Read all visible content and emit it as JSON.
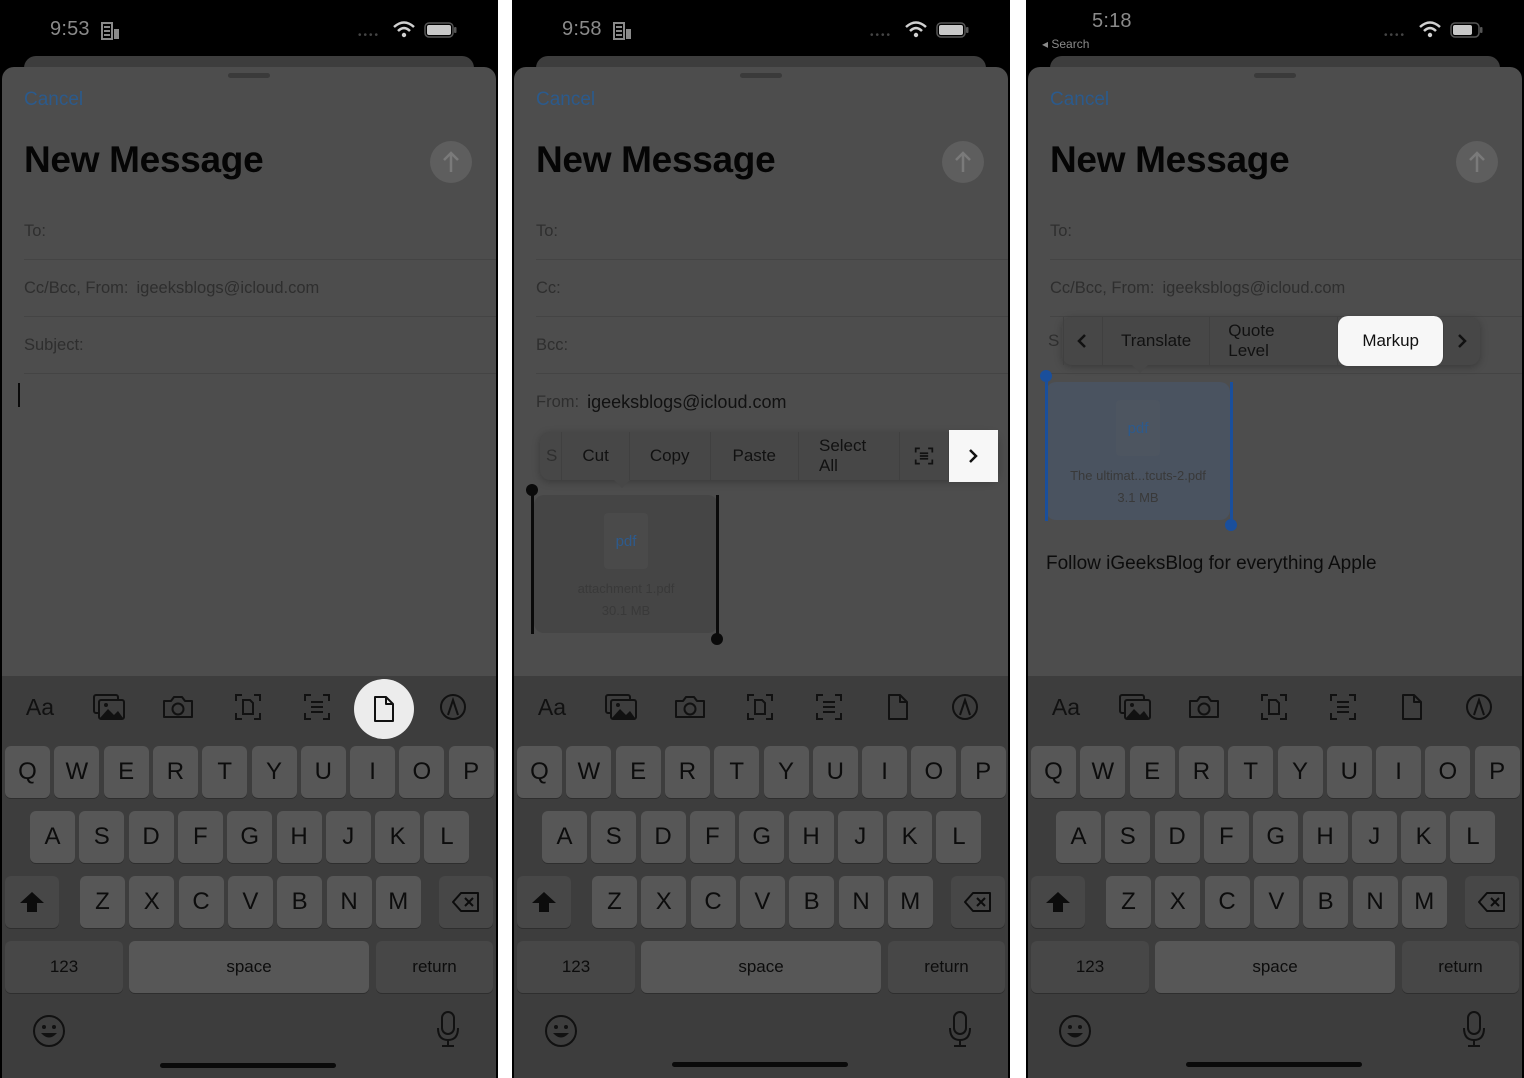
{
  "panels": [
    {
      "status": {
        "time": "9:53",
        "back_label": null
      },
      "compose": {
        "cancel": "Cancel",
        "title": "New Message",
        "fields": [
          {
            "label": "To:",
            "value": ""
          },
          {
            "label": "Cc/Bcc, From:",
            "value": "igeeksblogs@icloud.com"
          },
          {
            "label": "Subject:",
            "value": ""
          }
        ]
      },
      "toolbar": {
        "items": [
          "format-text",
          "photo-library",
          "camera",
          "scan-document",
          "scan-text",
          "attach-file",
          "markup"
        ],
        "format_label": "Aa",
        "highlighted": "attach-file"
      }
    },
    {
      "status": {
        "time": "9:58",
        "back_label": null
      },
      "compose": {
        "cancel": "Cancel",
        "title": "New Message",
        "fields": [
          {
            "label": "To:",
            "value": ""
          },
          {
            "label": "Cc:",
            "value": ""
          },
          {
            "label": "Bcc:",
            "value": ""
          },
          {
            "label": "From:",
            "value": "igeeksblogs@icloud.com"
          }
        ]
      },
      "context_menu": {
        "clipped_label": "S",
        "items": [
          "Cut",
          "Copy",
          "Paste",
          "Select All"
        ],
        "scan_icon": "scan-text-icon",
        "next_icon": "chevron-right-icon",
        "highlighted": "next"
      },
      "attachment": {
        "type_label": "pdf",
        "name": "attachment 1.pdf",
        "size": "30.1 MB"
      },
      "toolbar": {
        "items": [
          "format-text",
          "photo-library",
          "camera",
          "scan-document",
          "scan-text",
          "attach-file",
          "markup"
        ],
        "format_label": "Aa",
        "highlighted": null
      }
    },
    {
      "status": {
        "time": "5:18",
        "back_label": "◂ Search"
      },
      "compose": {
        "cancel": "Cancel",
        "title": "New Message",
        "fields": [
          {
            "label": "To:",
            "value": ""
          },
          {
            "label": "Cc/Bcc, From:",
            "value": "igeeksblogs@icloud.com"
          }
        ]
      },
      "context_menu": {
        "clipped_label": "S",
        "prev_icon": "chevron-left-icon",
        "items": [
          "Translate",
          "Quote Level",
          "Markup"
        ],
        "next_icon": "chevron-right-icon",
        "highlighted": "Markup"
      },
      "attachment": {
        "type_label": "pdf",
        "name": "The ultimat...tcuts-2.pdf",
        "size": "3.1 MB"
      },
      "body_text": "Follow iGeeksBlog for everything Apple",
      "toolbar": {
        "items": [
          "format-text",
          "photo-library",
          "camera",
          "scan-document",
          "scan-text",
          "attach-file",
          "markup"
        ],
        "format_label": "Aa",
        "highlighted": null
      }
    }
  ],
  "keyboard": {
    "row1": [
      "Q",
      "W",
      "E",
      "R",
      "T",
      "Y",
      "U",
      "I",
      "O",
      "P"
    ],
    "row2": [
      "A",
      "S",
      "D",
      "F",
      "G",
      "H",
      "J",
      "K",
      "L"
    ],
    "row3": [
      "Z",
      "X",
      "C",
      "V",
      "B",
      "N",
      "M"
    ],
    "numbers_key": "123",
    "space_key": "space",
    "return_key": "return"
  },
  "colors": {
    "accent_blue": "#2b5a8c",
    "selection_blue": "#1a4f9c",
    "highlight": "#f4f4f4"
  }
}
